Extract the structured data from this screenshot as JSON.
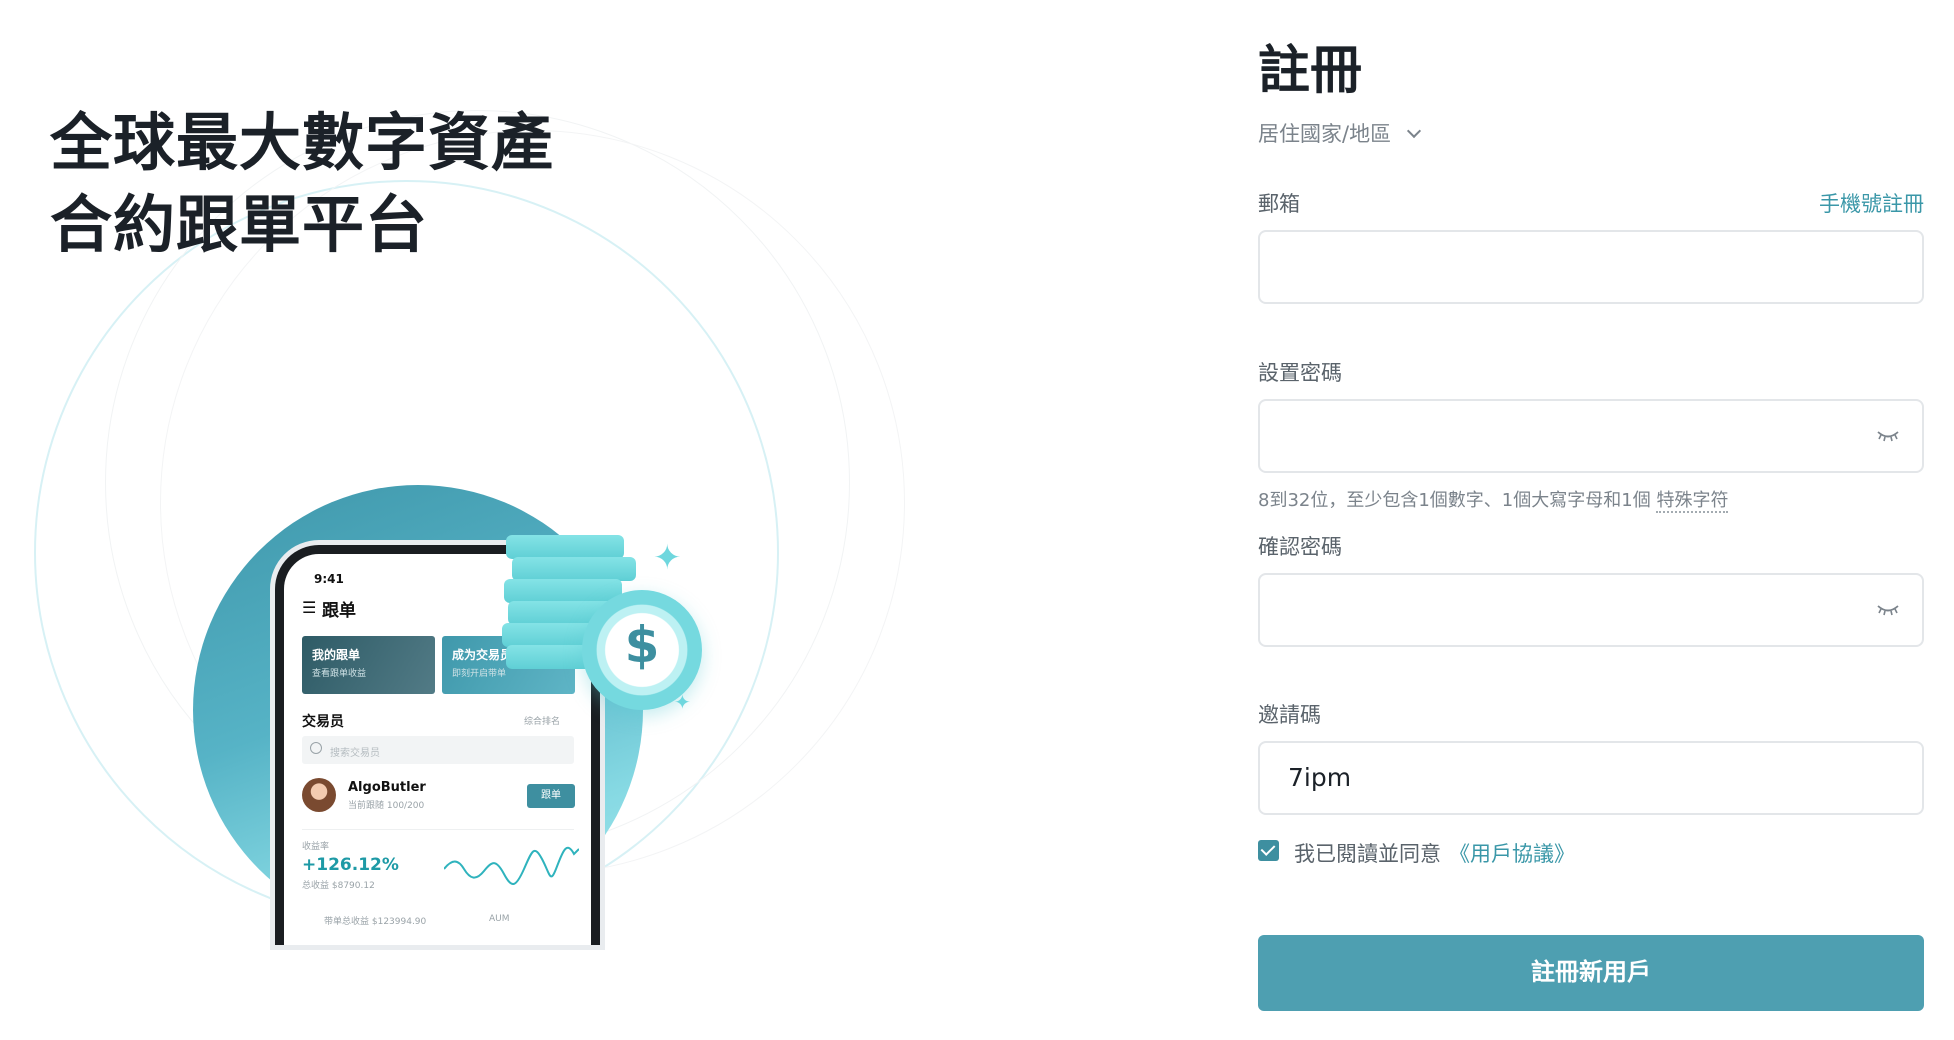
{
  "hero": {
    "headline_line1": "全球最大數字資產",
    "headline_line2": "合約跟單平台"
  },
  "phone_mock": {
    "time": "9:41",
    "title": "跟单",
    "cards": [
      {
        "title": "我的跟单",
        "subtitle": "查看跟单收益"
      },
      {
        "title": "成为交易员",
        "subtitle": "即刻开启带单"
      }
    ],
    "section": "交易员",
    "sort": "综合排名",
    "search_placeholder": "搜索交易员",
    "trader": {
      "name": "AlgoButler",
      "sub": "当前跟随 100/200",
      "follow": "跟单",
      "rate_label": "收益率",
      "rate": "+126.12%",
      "total": "总收益 $8790.12"
    },
    "footer_left": "带单总收益 $123994.90",
    "footer_right": "AUM"
  },
  "coin_symbol": "$",
  "form": {
    "title": "註冊",
    "country_label": "居住國家/地區",
    "email_label": "郵箱",
    "phone_register_link": "手機號註冊",
    "email_value": "",
    "password_label": "設置密碼",
    "password_hint": "8到32位，至少包含1個數字、1個大寫字母和1個",
    "password_hint_link": "特殊字符",
    "confirm_label": "確認密碼",
    "invite_label": "邀請碼",
    "invite_value": "7ipm",
    "agree_text": "我已閱讀並同意",
    "agree_link": "《用戶協議》",
    "agree_checked": true,
    "submit_label": "註冊新用戶"
  },
  "colors": {
    "accent": "#3a97a8",
    "button": "#4e9fb1",
    "text": "#1b2128"
  }
}
